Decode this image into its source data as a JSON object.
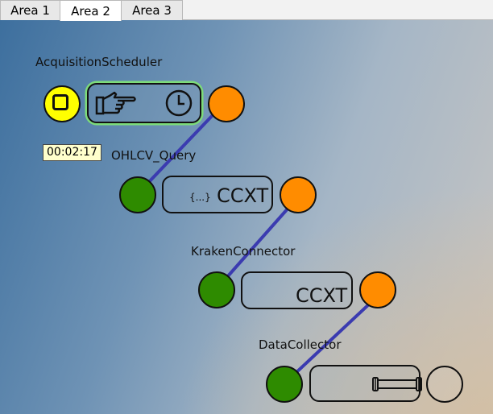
{
  "tabs": [
    {
      "label": "Area 1",
      "active": false
    },
    {
      "label": "Area 2",
      "active": true
    },
    {
      "label": "Area 3",
      "active": false
    }
  ],
  "nodes": {
    "acquisition_scheduler": {
      "title": "AcquisitionScheduler",
      "icons": [
        "pointing-hand-icon",
        "clock-icon"
      ]
    },
    "ohlcv_query": {
      "title": "OHLCV_Query",
      "brace": "{...}",
      "text": "CCXT"
    },
    "kraken_connector": {
      "title": "KrakenConnector",
      "text": "CCXT"
    },
    "data_collector": {
      "title": "DataCollector",
      "icons": [
        "pipe-icon"
      ]
    }
  },
  "timer": "00:02:17",
  "colors": {
    "wire": "#3b3bb0",
    "input_port": "#2e8b00",
    "output_port": "#ff8c00",
    "stop_port": "#ffff00",
    "selected_outline": "#7ddc7a"
  }
}
